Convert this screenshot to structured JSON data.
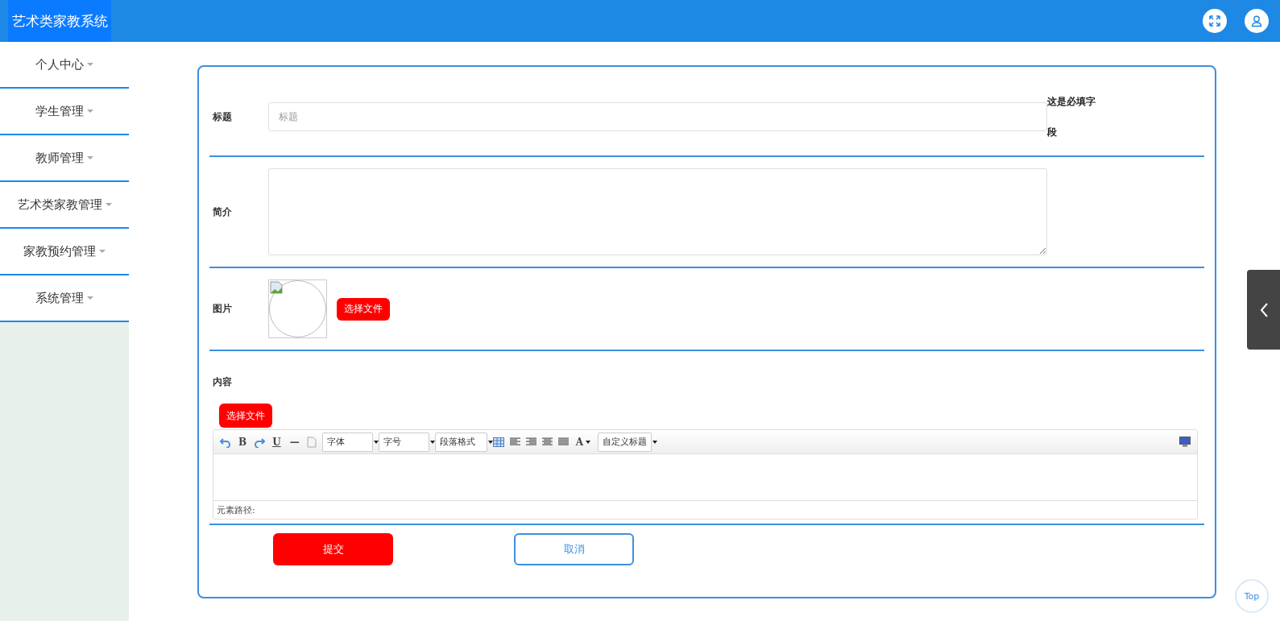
{
  "header": {
    "title": "艺术类家教系统"
  },
  "sidebar": {
    "items": [
      {
        "label": "个人中心"
      },
      {
        "label": "学生管理"
      },
      {
        "label": "教师管理"
      },
      {
        "label": "艺术类家教管理"
      },
      {
        "label": "家教预约管理"
      },
      {
        "label": "系统管理"
      }
    ]
  },
  "form": {
    "title_field": {
      "label": "标题",
      "placeholder": "标题",
      "required_note": "这是必填字段"
    },
    "summary_field": {
      "label": "简介"
    },
    "image_field": {
      "label": "图片",
      "upload_button": "选择文件"
    },
    "content_field": {
      "label": "内容",
      "upload_button": "选择文件",
      "toolbar": {
        "glyphs": [
          "B",
          "U",
          "—",
          "A"
        ],
        "selects": [
          "字体",
          "字号",
          "段落格式",
          "自定义标题"
        ]
      },
      "status_bar": "元素路径:"
    },
    "buttons": [
      {
        "label": "提交",
        "kind": "primary"
      },
      {
        "label": "取消",
        "kind": "secondary"
      }
    ]
  },
  "back_to_top": {
    "label": "Top"
  }
}
